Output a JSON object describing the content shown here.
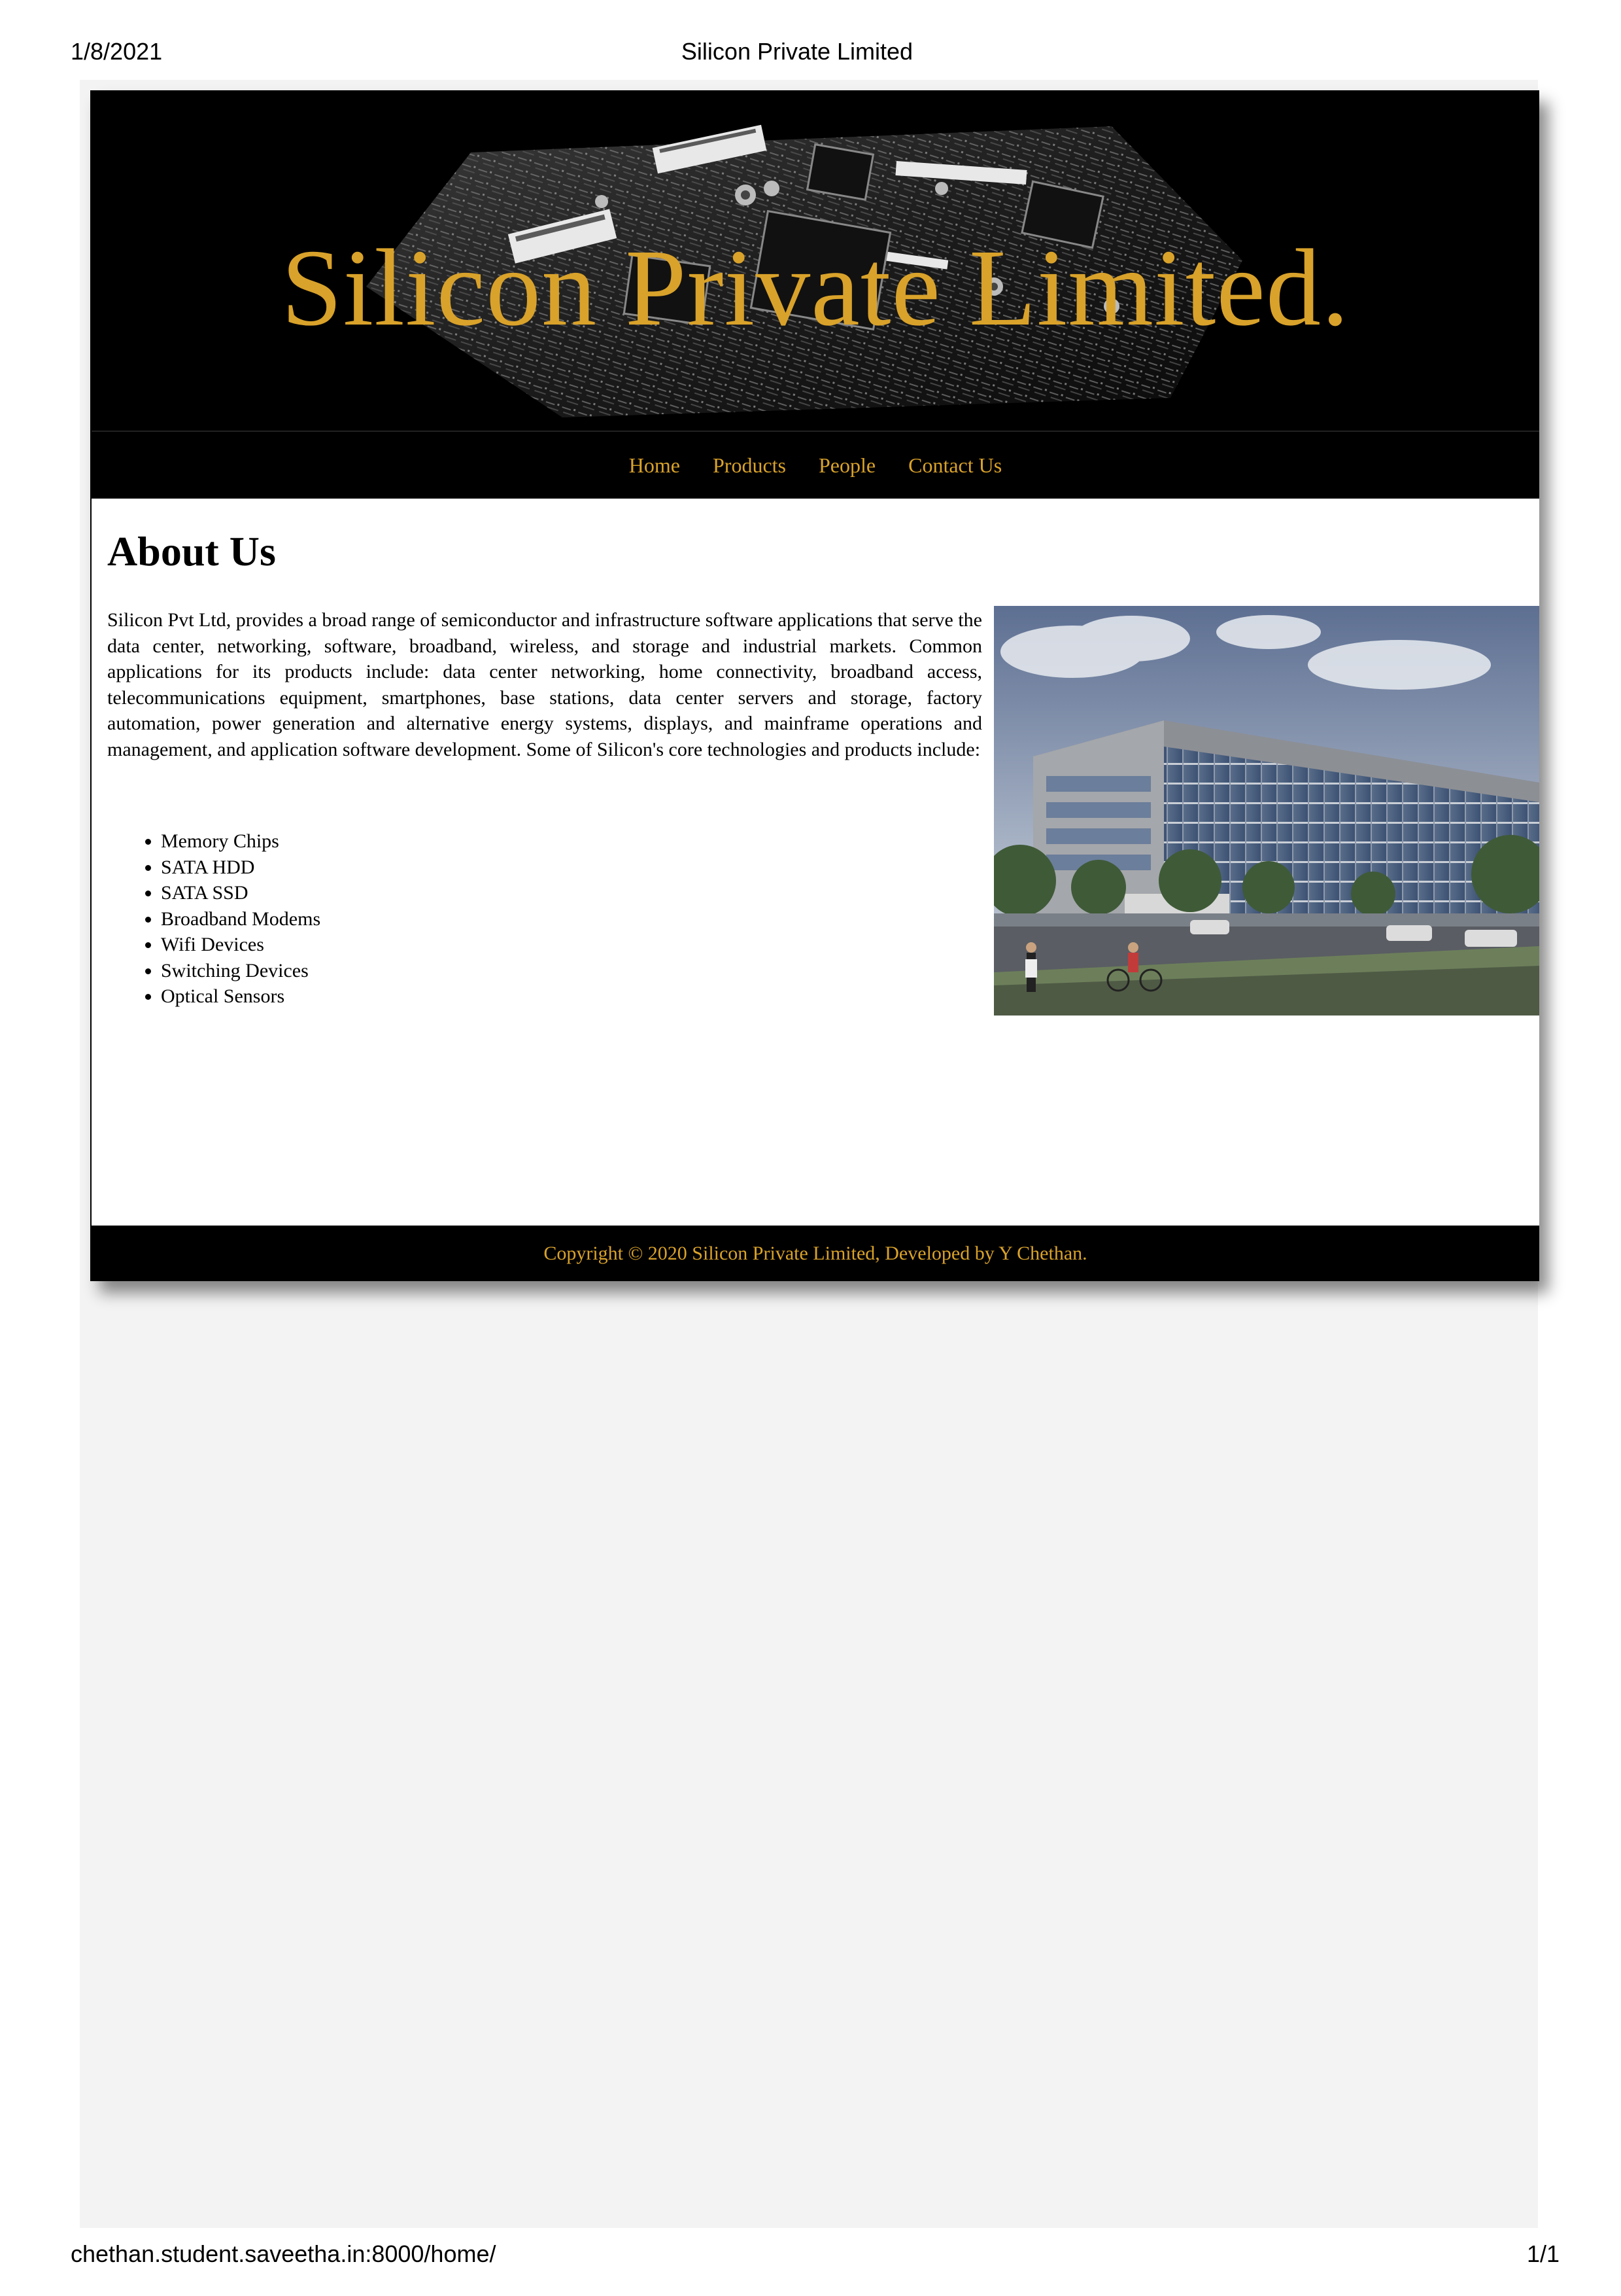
{
  "print_header": {
    "date": "1/8/2021",
    "title": "Silicon Private Limited"
  },
  "print_footer": {
    "url": "chethan.student.saveetha.in:8000/home/",
    "page": "1/1"
  },
  "banner": {
    "title": "Silicon Private Limited.",
    "image": "circuit-board-photo"
  },
  "nav": {
    "items": [
      {
        "label": "Home"
      },
      {
        "label": "Products"
      },
      {
        "label": "People"
      },
      {
        "label": "Contact Us"
      }
    ]
  },
  "about": {
    "heading": "About Us",
    "paragraph": "Silicon Pvt Ltd, provides a broad range of semiconductor and infrastructure software applications that serve the data center, networking, software, broadband, wireless, and storage and industrial markets. Common applications for its products include: data center networking, home connectivity, broadband access, telecommunications equipment, smartphones, base stations, data center servers and storage, factory automation, power generation and alternative energy systems, displays, and mainframe operations and management, and application software development. Some of Silicon's core technologies and products include:",
    "technologies": [
      "Memory Chips",
      "SATA HDD",
      "SATA SSD",
      "Broadband Modems",
      "Wifi Devices",
      "Switching Devices",
      "Optical Sensors"
    ],
    "image": "office-building-photo"
  },
  "footer": {
    "copyright": "Copyright © 2020 Silicon Private Limited, Developed by Y Chethan."
  },
  "colors": {
    "accent": "#d9a22a",
    "banner_bg": "#000000",
    "page_bg": "#f3f3f3"
  }
}
